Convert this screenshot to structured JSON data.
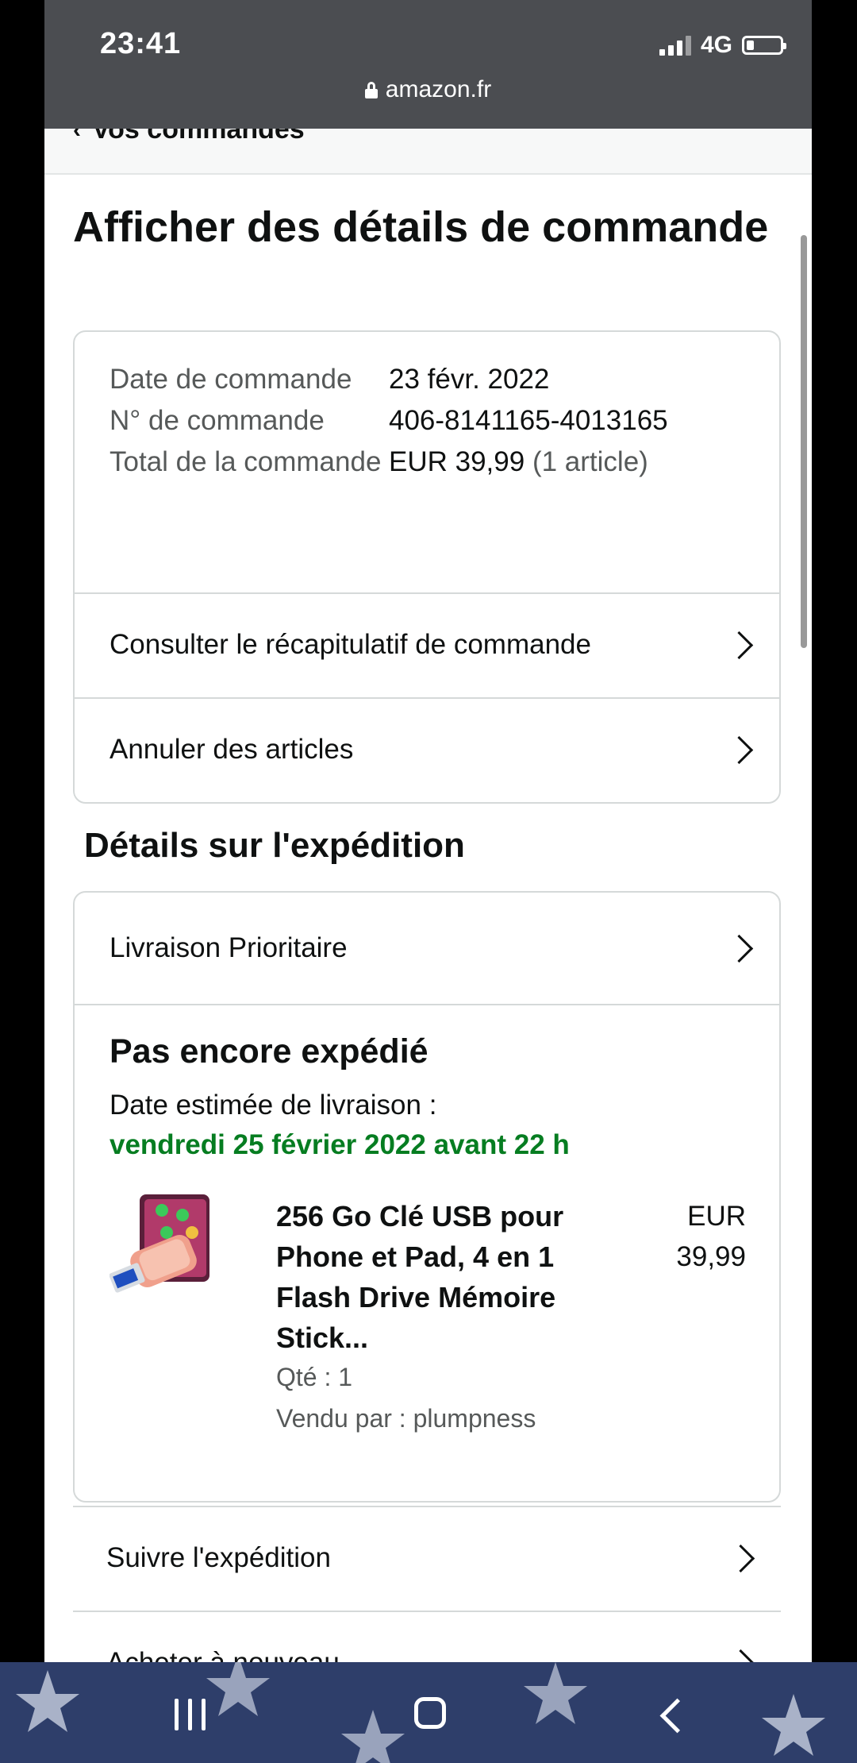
{
  "status_bar": {
    "time": "23:41",
    "network": "4G",
    "url": "amazon.fr"
  },
  "breadcrumb": {
    "label": "Vos commandes"
  },
  "page": {
    "title": "Afficher des détails de commande"
  },
  "order_summary": {
    "date_label": "Date de commande",
    "date_value": "23 févr. 2022",
    "number_label": "N° de commande",
    "number_value": "406-8141165-4013165",
    "total_label": "Total de la commande",
    "total_value": "EUR 39,99",
    "total_items": "(1 article)",
    "links": [
      {
        "label": "Consulter le récapitulatif de commande"
      },
      {
        "label": "Annuler des articles"
      }
    ]
  },
  "shipping": {
    "section_title": "Détails sur l'expédition",
    "method": "Livraison Prioritaire",
    "status": "Pas encore expédié",
    "eta_label": "Date estimée de livraison :",
    "eta_date": "vendredi 25 février 2022 avant 22 h",
    "eta_color": "#067d21",
    "product": {
      "title": "256 Go Clé USB pour Phone et Pad, 4 en 1 Flash Drive Mémoire Stick...",
      "currency": "EUR",
      "price": "39,99",
      "qty": "Qté : 1",
      "seller": "Vendu par : plumpness"
    }
  },
  "actions": [
    {
      "label": "Suivre l'expédition"
    },
    {
      "label": "Acheter à nouveau"
    }
  ],
  "nav_bar": {
    "icons": [
      "recent-apps-icon",
      "home-icon",
      "back-icon"
    ]
  }
}
